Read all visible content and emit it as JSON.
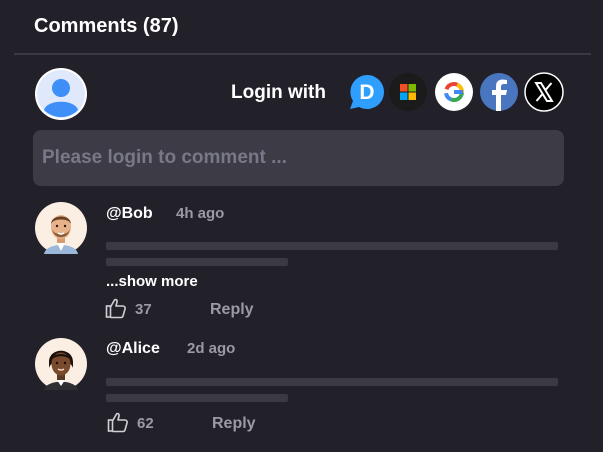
{
  "header": {
    "title": "Comments (87)"
  },
  "login": {
    "label": "Login with",
    "providers": [
      {
        "name": "disqus-icon",
        "color": "#2e9fff"
      },
      {
        "name": "microsoft-icon",
        "colors": [
          "#f25022",
          "#7fba00",
          "#00a4ef",
          "#ffb900"
        ]
      },
      {
        "name": "google-icon",
        "colors": [
          "#4285f4",
          "#34a853",
          "#fbbc05",
          "#ea4335"
        ]
      },
      {
        "name": "facebook-icon",
        "color": "#4a76bf"
      },
      {
        "name": "x-icon",
        "color": "#000000"
      }
    ]
  },
  "composer": {
    "placeholder": "Please login to comment ..."
  },
  "comments": [
    {
      "user": "@Bob",
      "time": "4h ago",
      "show_more": "...show more",
      "likes": "37",
      "reply": "Reply"
    },
    {
      "user": "@Alice",
      "time": "2d ago",
      "likes": "62",
      "reply": "Reply"
    }
  ],
  "colors": {
    "background": "#22212a",
    "input_bg": "#3c3b46",
    "muted_text": "#9a99a5",
    "avatar_blue": "#3e8ff7"
  }
}
